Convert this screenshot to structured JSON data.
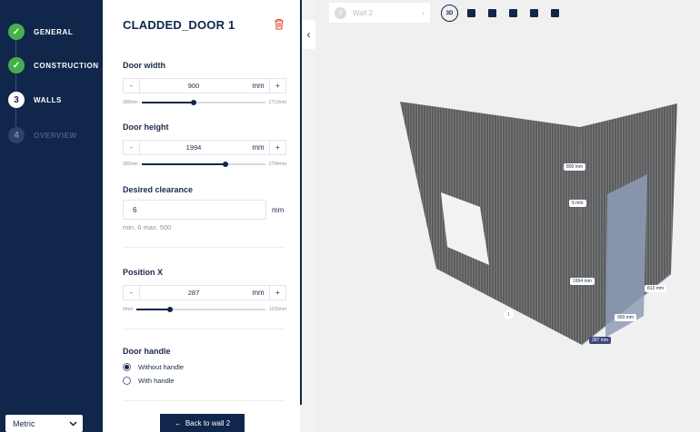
{
  "stepper": {
    "steps": [
      {
        "number": "✓",
        "label": "GENERAL",
        "state": "done"
      },
      {
        "number": "✓",
        "label": "CONSTRUCTION",
        "state": "done"
      },
      {
        "number": "3",
        "label": "WALLS",
        "state": "current"
      },
      {
        "number": "4",
        "label": "OVERVIEW",
        "state": "todo"
      }
    ],
    "unit_select": {
      "value": "Metric"
    }
  },
  "panel": {
    "title": "CLADDED_DOOR 1",
    "door_width": {
      "label": "Door width",
      "minus": "-",
      "value": "900",
      "unit": "mm",
      "plus": "+",
      "min": "300mm",
      "max": "1713mm",
      "fraction": 0.42
    },
    "door_height": {
      "label": "Door height",
      "minus": "-",
      "value": "1994",
      "unit": "mm",
      "plus": "+",
      "min": "300mm",
      "max": "2794mm",
      "fraction": 0.68
    },
    "clearance": {
      "label": "Desired clearance",
      "value": "6",
      "unit": "mm",
      "hint": "min. 6 max. 500"
    },
    "position_x": {
      "label": "Position X",
      "minus": "-",
      "value": "287",
      "unit": "mm",
      "plus": "+",
      "min": "0mm",
      "max": "1100mm",
      "fraction": 0.26
    },
    "door_handle": {
      "label": "Door handle",
      "options": [
        {
          "label": "Without handle",
          "selected": true
        },
        {
          "label": "With handle",
          "selected": false
        }
      ]
    },
    "back_button": "Back to wall 2"
  },
  "viewport": {
    "wall_tab": {
      "number": "2",
      "label": "Wall 2"
    },
    "view_mode": "3D",
    "dimensions": [
      "800 mm",
      "6 mm",
      "1994 mm",
      "900 mm",
      "287 mm",
      "813 mm"
    ],
    "marker": "1"
  },
  "colors": {
    "navy": "#10264b",
    "green": "#45b04b",
    "wall": "#5f6163",
    "door": "#8e9cb5"
  }
}
